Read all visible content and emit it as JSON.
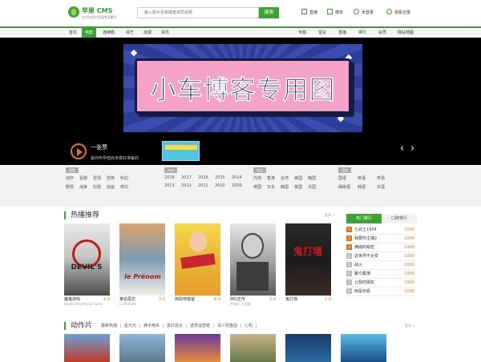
{
  "brand": {
    "name": "苹果 CMS",
    "slogan": "全力为用户呈现专业影片",
    "colors": {
      "accent": "#3aa331",
      "highlight": "#e3741a"
    }
  },
  "search": {
    "placeholder": "输入影片名称或者演员名称",
    "button": "搜索"
  },
  "topnav": [
    {
      "label": "直播",
      "icon": "tv-icon"
    },
    {
      "label": "榜单",
      "icon": "chart-icon"
    },
    {
      "label": "未登录",
      "icon": "user-icon"
    },
    {
      "label": "观看记录",
      "icon": "clock-icon"
    }
  ],
  "menu": {
    "left": [
      "首页",
      "电影",
      "连续剧",
      "综艺",
      "动漫",
      "资讯"
    ],
    "right": [
      "专题",
      "留言",
      "直播",
      "排行",
      "会员",
      "网站地图"
    ],
    "active_index": 1
  },
  "banner": {
    "poster_text": "小车博客专用图",
    "slide_title": "一张票",
    "slide_sub": "最你怀孕但尚未像好准备的"
  },
  "filters": [
    {
      "tag": "类型",
      "items": [
        "动作",
        "喜剧",
        "爱情",
        "恐怖",
        "科幻",
        "剧情",
        "战争",
        "犯罪",
        "动画",
        "奇幻"
      ]
    },
    {
      "tag": "年份",
      "items": [
        "2018",
        "2017",
        "2016",
        "2015",
        "2014",
        "2013",
        "2012",
        "2011",
        "2010",
        "2009"
      ]
    },
    {
      "tag": "地区",
      "items": [
        "内地",
        "香港",
        "台湾",
        "美国",
        "韩国",
        "英国",
        "日本",
        "韩国",
        "泰国",
        "法国"
      ]
    },
    {
      "tag": "语言",
      "items": [
        "国语",
        "英语",
        "粤语",
        "闽南语",
        "韩语",
        "日语"
      ]
    }
  ],
  "hot": {
    "title": "热播推荐",
    "more": "更多 >"
  },
  "movies": [
    {
      "title": "魔鬼游戏",
      "sub": "Devils Play Knock Twice",
      "score": "1.0"
    },
    {
      "title": "某名尾恋",
      "sub": "Le Prénom",
      "score": "3.0"
    },
    {
      "title": "摔跤吧爸爸",
      "sub": "",
      "score": "8.0"
    },
    {
      "title": "阿Q正传",
      "sub": "严顺开 王文娟",
      "score": "5.0"
    },
    {
      "title": "鬼打墙",
      "sub": "",
      "score": "1.0"
    }
  ],
  "rank": {
    "tabs": [
      "热门排行",
      "口碑排行"
    ],
    "items": [
      {
        "title": "七武士1954",
        "value": "1000"
      },
      {
        "title": "我要你主播2",
        "value": "1000"
      },
      {
        "title": "满城的秘密",
        "value": "1000"
      },
      {
        "title": "这世界不太安",
        "value": "1000"
      },
      {
        "title": "战火",
        "value": "1000"
      },
      {
        "title": "聚众集博",
        "value": "1000"
      },
      {
        "title": "让我的朋友",
        "value": "1000"
      },
      {
        "title": "她是快看",
        "value": "1000"
      }
    ]
  },
  "action": {
    "title": "动作片",
    "more": "更多 >",
    "subnav": [
      "最新热播",
      "星元元",
      "蜂手绝杀",
      "黑红抗水",
      "选举运营者",
      "青少凯盘血",
      "心机"
    ]
  }
}
